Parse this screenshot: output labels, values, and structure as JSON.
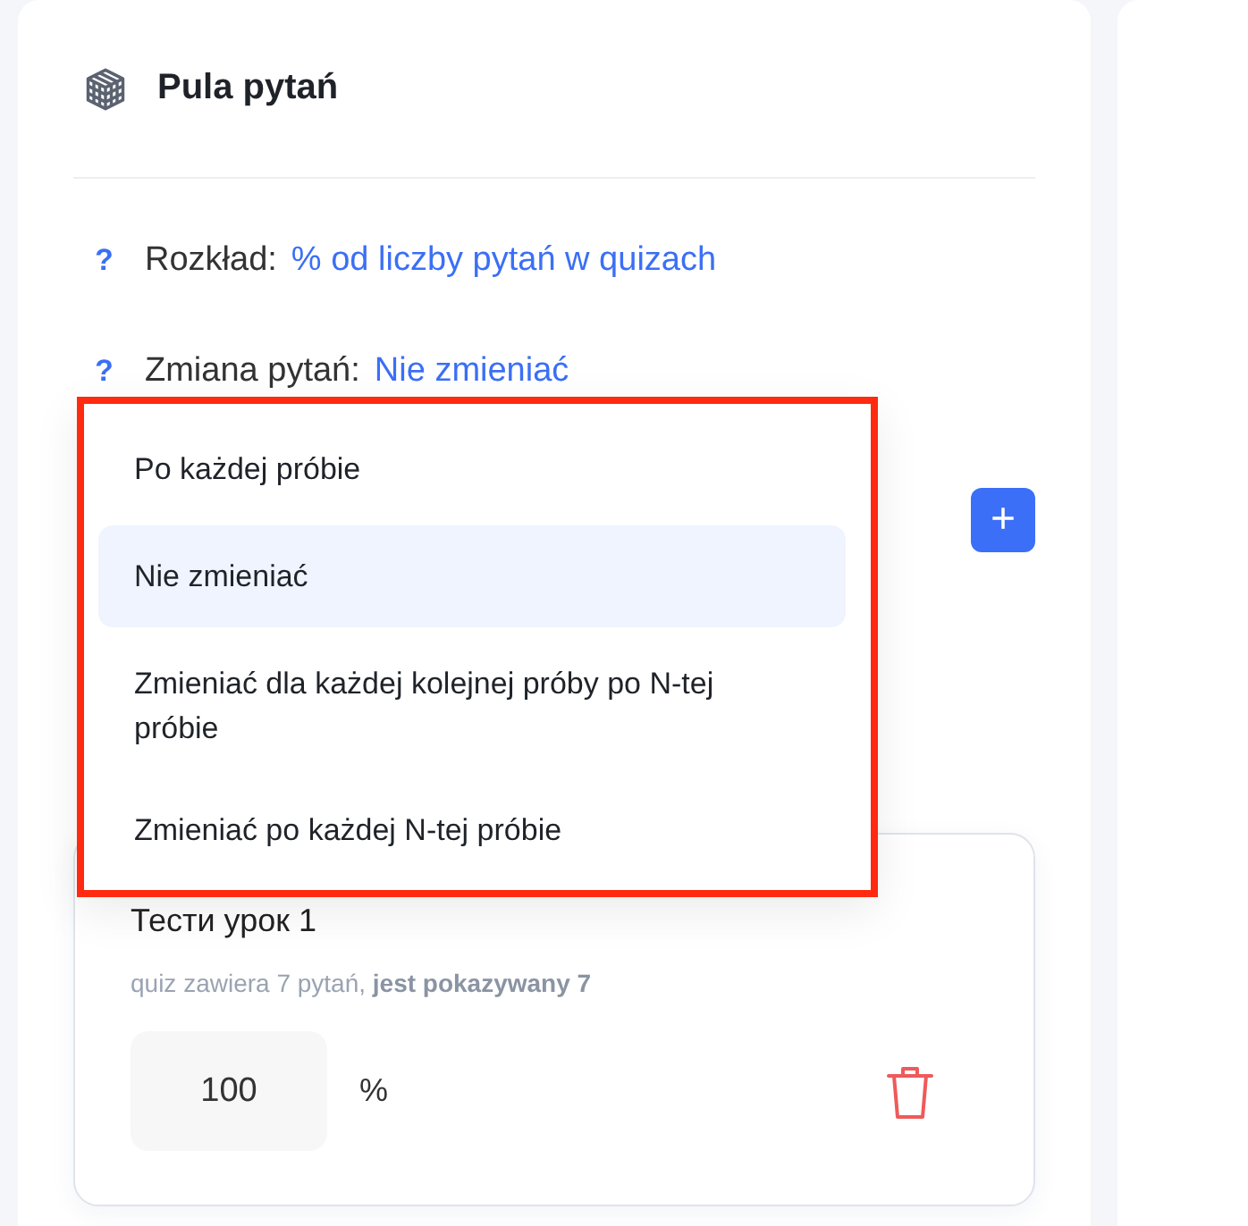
{
  "panel": {
    "title": "Pula pytań",
    "settings": [
      {
        "help": "?",
        "label": "Rozkład:",
        "value": "% od liczby pytań w quizach"
      },
      {
        "help": "?",
        "label": "Zmiana pytań:",
        "value": "Nie zmieniać"
      }
    ],
    "add_button": "+",
    "dropdown": {
      "options": [
        {
          "label": "Po każdej próbie",
          "selected": false
        },
        {
          "label": "Nie zmieniać",
          "selected": true
        },
        {
          "label": "Zmieniać dla każdej kolejnej próby po N-tej próbie",
          "selected": false
        },
        {
          "label": "Zmieniać po każdej N-tej próbie",
          "selected": false
        }
      ]
    },
    "quizzes": [
      {
        "title": "Тести урок 1",
        "info": "quiz zawiera 7 pytań, **jest pokazywany 7**",
        "value": "100",
        "unit": "%"
      }
    ]
  }
}
